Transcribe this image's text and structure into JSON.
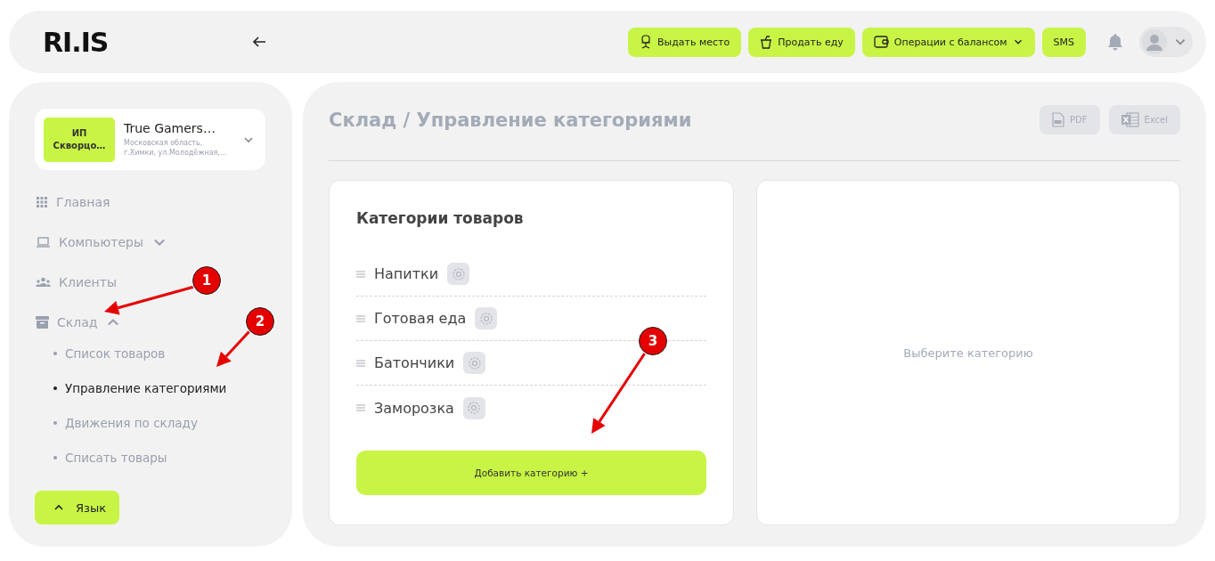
{
  "header": {
    "logo": "RI.IS",
    "actions": [
      {
        "label": "Выдать место",
        "dropdown": false
      },
      {
        "label": "Продать еду",
        "dropdown": false
      },
      {
        "label": "Операции с балансом",
        "dropdown": true
      },
      {
        "label": "SMS",
        "dropdown": false
      }
    ]
  },
  "sidebar": {
    "company": {
      "badge": "ИП Скворцо…",
      "name": "True Gamers…",
      "address": "Московская область,\nг.Химки, ул.Молодёжная,…"
    },
    "items": [
      {
        "label": "Главная"
      },
      {
        "label": "Компьютеры",
        "expanded": false
      },
      {
        "label": "Клиенты"
      },
      {
        "label": "Склад",
        "expanded": true,
        "children": [
          {
            "label": "Список товаров",
            "selected": false
          },
          {
            "label": "Управление категориями",
            "selected": true
          },
          {
            "label": "Движения по складу",
            "selected": false
          },
          {
            "label": "Списать товары",
            "selected": false
          }
        ]
      }
    ],
    "language_button": "Язык"
  },
  "main": {
    "title": "Склад / Управление категориями",
    "exports": [
      "PDF",
      "Excel"
    ],
    "categories": {
      "title": "Категории товаров",
      "items": [
        "Напитки",
        "Готовая еда",
        "Батончики",
        "Заморозка"
      ],
      "add_button": "Добавить категорию +"
    },
    "detail": {
      "placeholder": "Выберите категорию"
    }
  },
  "annotations": [
    "1",
    "2",
    "3"
  ]
}
